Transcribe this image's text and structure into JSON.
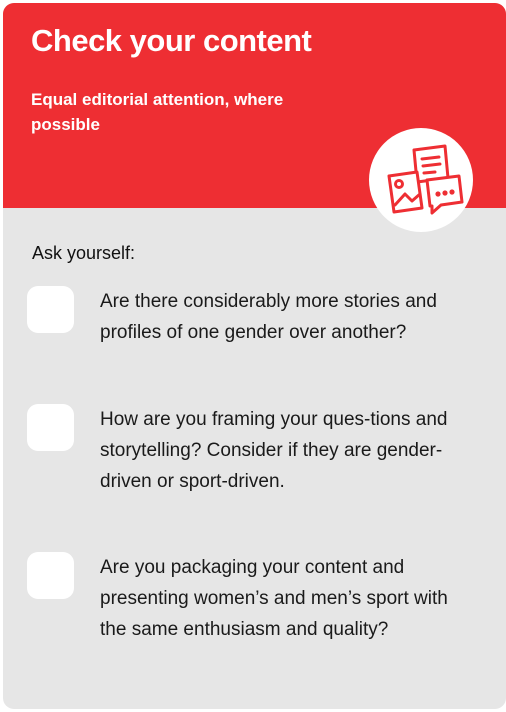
{
  "header": {
    "title": "Check your content",
    "subtitle": "Equal editorial attention, where possible",
    "emblem_icon": "content-documents-icon",
    "accent_color": "#ee2e33"
  },
  "checklist": {
    "intro": "Ask yourself:",
    "items": [
      {
        "text": "Are there considerably more stories and profiles of one gender over another?",
        "checked": false
      },
      {
        "text": "How are you framing your ques-tions and storytelling? Consider if they are gender-driven or sport-driven.",
        "checked": false
      },
      {
        "text": "Are you packaging your content and presenting women’s and men’s sport with the same enthusiasm and quality?",
        "checked": false
      }
    ]
  }
}
